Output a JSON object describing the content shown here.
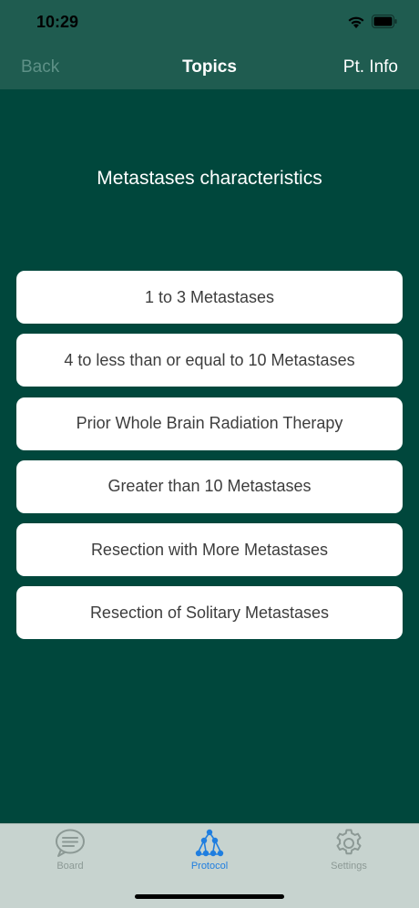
{
  "status_bar": {
    "time": "10:29"
  },
  "nav": {
    "back_label": "Back",
    "title": "Topics",
    "right_label": "Pt. Info"
  },
  "heading": "Metastases characteristics",
  "options": [
    "1 to 3 Metastases",
    "4 to less than or equal to 10 Metastases",
    "Prior Whole Brain Radiation Therapy",
    "Greater than 10 Metastases",
    "Resection with More Metastases",
    "Resection of Solitary Metastases"
  ],
  "tabs": [
    {
      "label": "Board",
      "icon": "chat-bubble-icon",
      "active": false
    },
    {
      "label": "Protocol",
      "icon": "tree-network-icon",
      "active": true
    },
    {
      "label": "Settings",
      "icon": "gear-icon",
      "active": false
    }
  ],
  "colors": {
    "background": "#00473c",
    "header": "#1f5c50",
    "tab_bar": "#c7d3cf",
    "active_tab": "#1f7ee0",
    "inactive_tab": "#8c9995"
  }
}
